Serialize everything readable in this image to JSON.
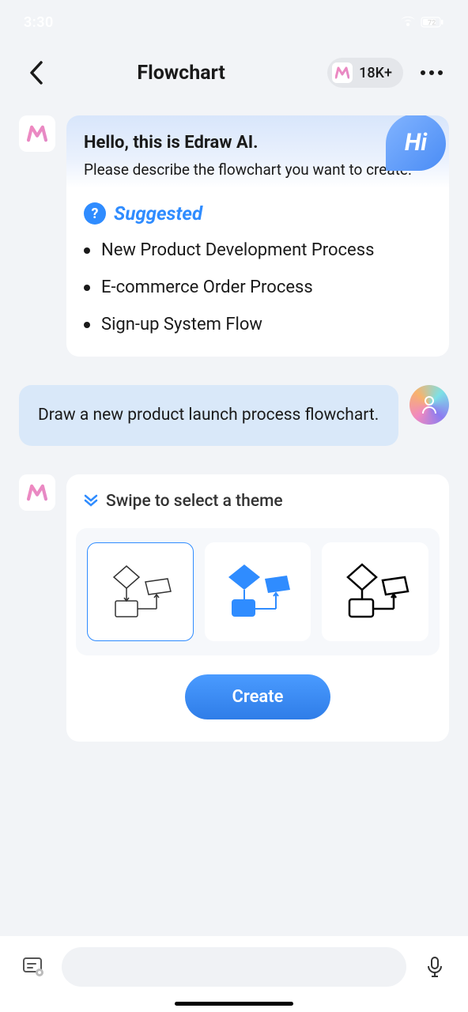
{
  "statusbar": {
    "time": "3:30",
    "battery": "72"
  },
  "header": {
    "title": "Flowchart",
    "badge_count": "18K+"
  },
  "intro": {
    "greeting": "Hello, this is Edraw AI.",
    "instruction": "Please describe the flowchart you want to create.",
    "hi_text": "Hi"
  },
  "suggested": {
    "label": "Suggested",
    "items": [
      "New Product Development Process",
      "E-commerce Order Process",
      "Sign-up System Flow"
    ]
  },
  "user_message": "Draw a new product launch process flowchart.",
  "theme": {
    "label": "Swipe to select a theme",
    "create_label": "Create"
  }
}
